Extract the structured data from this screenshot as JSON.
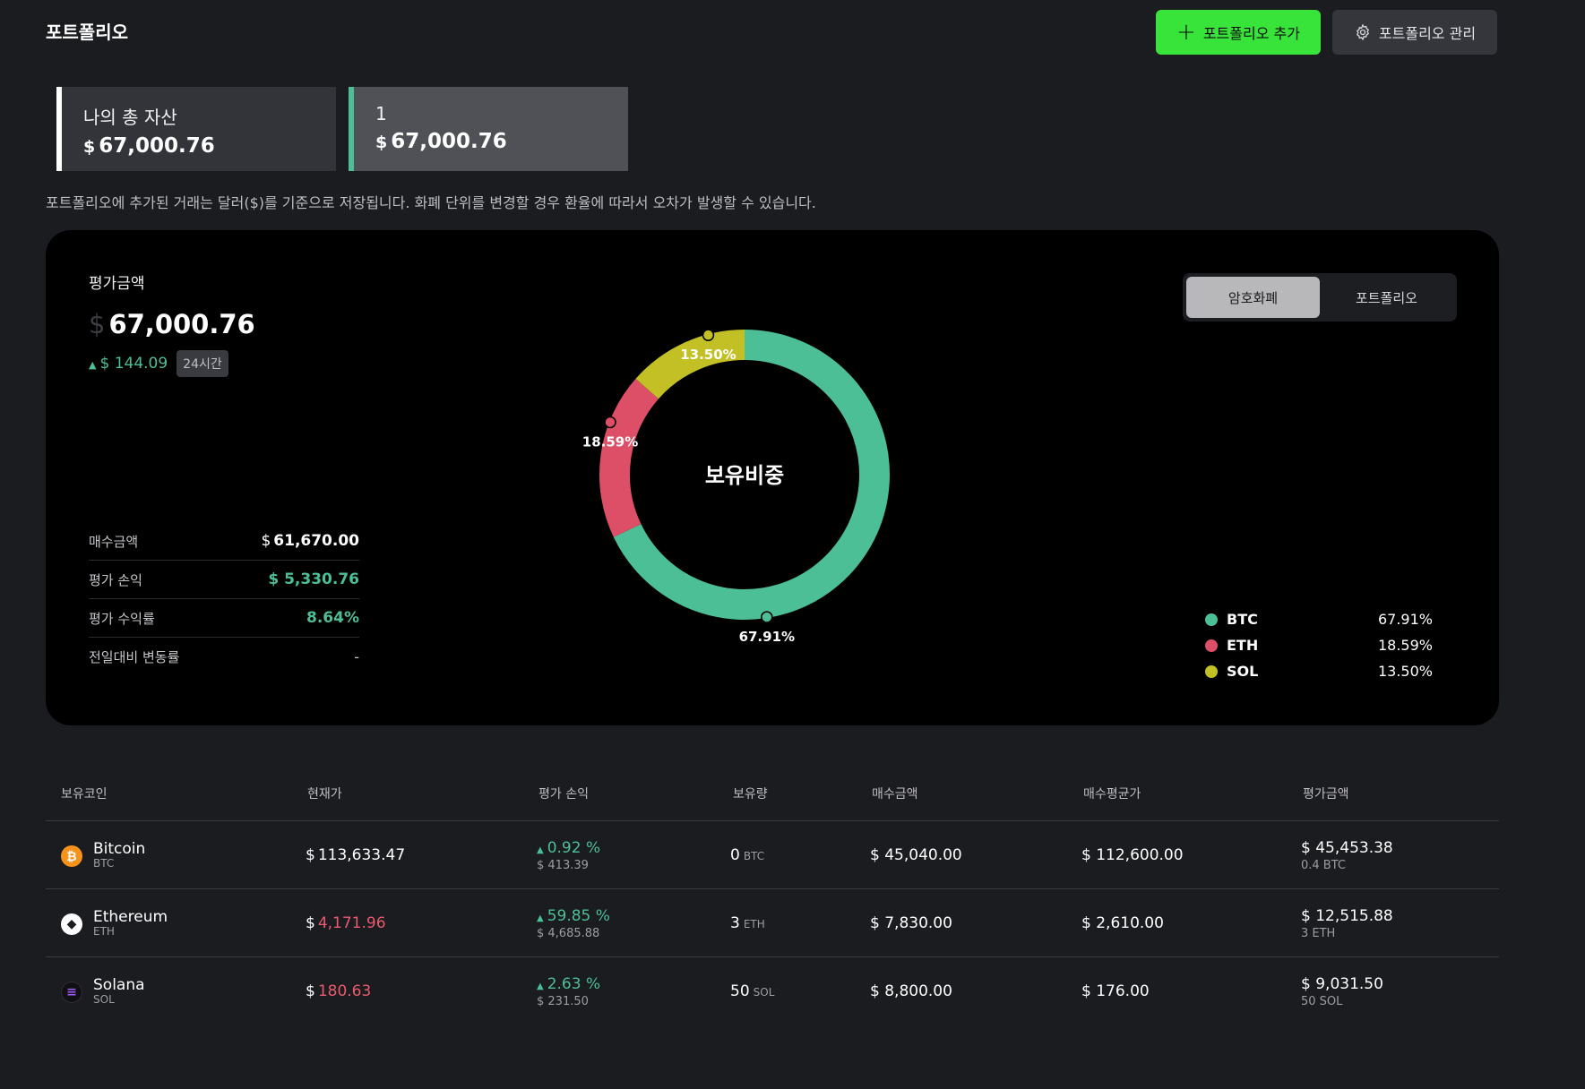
{
  "header": {
    "title": "포트폴리오",
    "add_button": "포트폴리오 추가",
    "manage_button": "포트폴리오 관리"
  },
  "cards": [
    {
      "name": "나의 총 자산",
      "currency": "$",
      "amount": "67,000.76"
    },
    {
      "name": "1",
      "currency": "$",
      "amount": "67,000.76"
    }
  ],
  "notice": "포트폴리오에 추가된 거래는 달러($)를 기준으로 저장됩니다. 화폐 단위를 변경할 경우 환율에 따라서 오차가 발생할 수 있습니다.",
  "summary": {
    "label": "평가금액",
    "currency": "$",
    "amount": "67,000.76",
    "change": "$ 144.09",
    "period": "24시간",
    "stats": [
      {
        "label": "매수금액",
        "currency": "$",
        "value": "61,670.00"
      },
      {
        "label": "평가 손익",
        "value": "$ 5,330.76"
      },
      {
        "label": "평가 수익률",
        "value": "8.64%"
      },
      {
        "label": "전일대비 변동률",
        "value": "-"
      }
    ]
  },
  "donut": {
    "center_label": "보유비중"
  },
  "toggle": {
    "tab_crypto": "암호화폐",
    "tab_portfolio": "포트폴리오"
  },
  "chart_data": {
    "type": "pie",
    "title": "",
    "categories": [
      "BTC",
      "ETH",
      "SOL"
    ],
    "values": [
      67.91,
      18.59,
      13.5
    ],
    "labels": [
      "67.91%",
      "18.59%",
      "13.50%"
    ],
    "colors": [
      "#4cbf96",
      "#dd4f67",
      "#c2c024"
    ],
    "legend": "bottom-right"
  },
  "table": {
    "headers": [
      "보유코인",
      "현재가",
      "평가 손익",
      "보유량",
      "매수금액",
      "매수평균가",
      "평가금액"
    ],
    "rows": [
      {
        "name": "Bitcoin",
        "symbol": "BTC",
        "icon": "bitcoin-icon",
        "icon_glyph": "₿",
        "icon_color": "#f7931a",
        "price": "113,633.47",
        "price_cur": "$",
        "price_red": false,
        "pl_pct": "0.92 %",
        "pl_amt": "$ 413.39",
        "qty": "0",
        "qty_unit": "BTC",
        "buy_amount": "$ 45,040.00",
        "avg_price": "$ 112,600.00",
        "eval": "$ 45,453.38",
        "eval_sub": "0.4 BTC"
      },
      {
        "name": "Ethereum",
        "symbol": "ETH",
        "icon": "ethereum-icon",
        "icon_glyph": "◆",
        "icon_color": "#ffffff",
        "price": "4,171.96",
        "price_cur": "$",
        "price_red": true,
        "pl_pct": "59.85 %",
        "pl_amt": "$ 4,685.88",
        "qty": "3",
        "qty_unit": "ETH",
        "buy_amount": "$ 7,830.00",
        "avg_price": "$ 2,610.00",
        "eval": "$ 12,515.88",
        "eval_sub": "3 ETH"
      },
      {
        "name": "Solana",
        "symbol": "SOL",
        "icon": "solana-icon",
        "icon_glyph": "≡",
        "icon_color": "#101014",
        "price": "180.63",
        "price_cur": "$",
        "price_red": true,
        "pl_pct": "2.63 %",
        "pl_amt": "$ 231.50",
        "qty": "50",
        "qty_unit": "SOL",
        "buy_amount": "$ 8,800.00",
        "avg_price": "$ 176.00",
        "eval": "$ 9,031.50",
        "eval_sub": "50 SOL"
      }
    ]
  }
}
